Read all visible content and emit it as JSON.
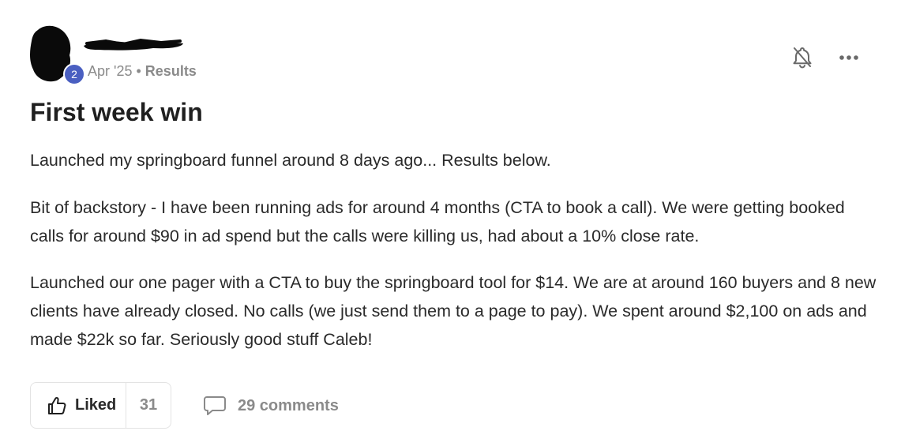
{
  "post": {
    "author": {
      "level": "2"
    },
    "meta": {
      "date": "Apr '25",
      "separator": "•",
      "category": "Results"
    },
    "title": "First week win",
    "paragraphs": [
      "Launched my springboard funnel around 8 days ago... Results below.",
      "Bit of backstory - I have been running ads for around 4 months (CTA to book a call). We were getting booked calls for around $90 in ad spend but the calls were killing us, had about a 10% close rate.",
      "Launched our one pager with a CTA to buy the springboard tool for $14. We are at around 160 buyers and 8 new clients have already closed. No calls (we just send them to a page to pay). We spent around $2,100 on ads and made $22k so far. Seriously good stuff Caleb!"
    ],
    "actions": {
      "like_label": "Liked",
      "like_count": "31",
      "comments_label": "29 comments"
    },
    "icons": {
      "bell": "bell-off-icon",
      "more": "more-horizontal-icon",
      "like": "thumbs-up-icon",
      "comment": "comment-bubble-icon"
    },
    "colors": {
      "level_badge": "#4a5fc1",
      "muted_text": "#8a8a8a",
      "body_text": "#2a2a2a"
    }
  }
}
